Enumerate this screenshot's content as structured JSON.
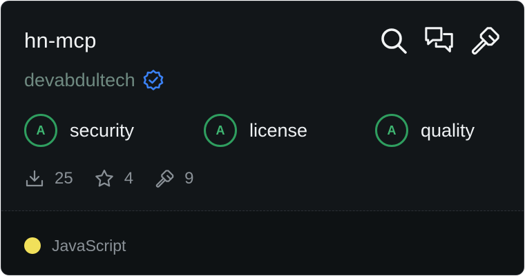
{
  "repo": {
    "name": "hn-mcp",
    "author": "devabdultech",
    "author_verified": true
  },
  "actions": [
    {
      "icon": "search-icon"
    },
    {
      "icon": "chat-icon"
    },
    {
      "icon": "hammer-icon"
    }
  ],
  "scores": [
    {
      "grade": "A",
      "label": "security"
    },
    {
      "grade": "A",
      "label": "license"
    },
    {
      "grade": "A",
      "label": "quality"
    }
  ],
  "stats": {
    "downloads": "25",
    "stars": "4",
    "tools": "9"
  },
  "language": {
    "name": "JavaScript",
    "color": "#f1e05a"
  },
  "colors": {
    "card_bg": "#121619",
    "footer_bg": "#0e1214",
    "grade_ring": "#2f9e5f",
    "grade_text": "#3fb772",
    "author_text": "#6f8a81",
    "verified_badge": "#3b82f6"
  }
}
